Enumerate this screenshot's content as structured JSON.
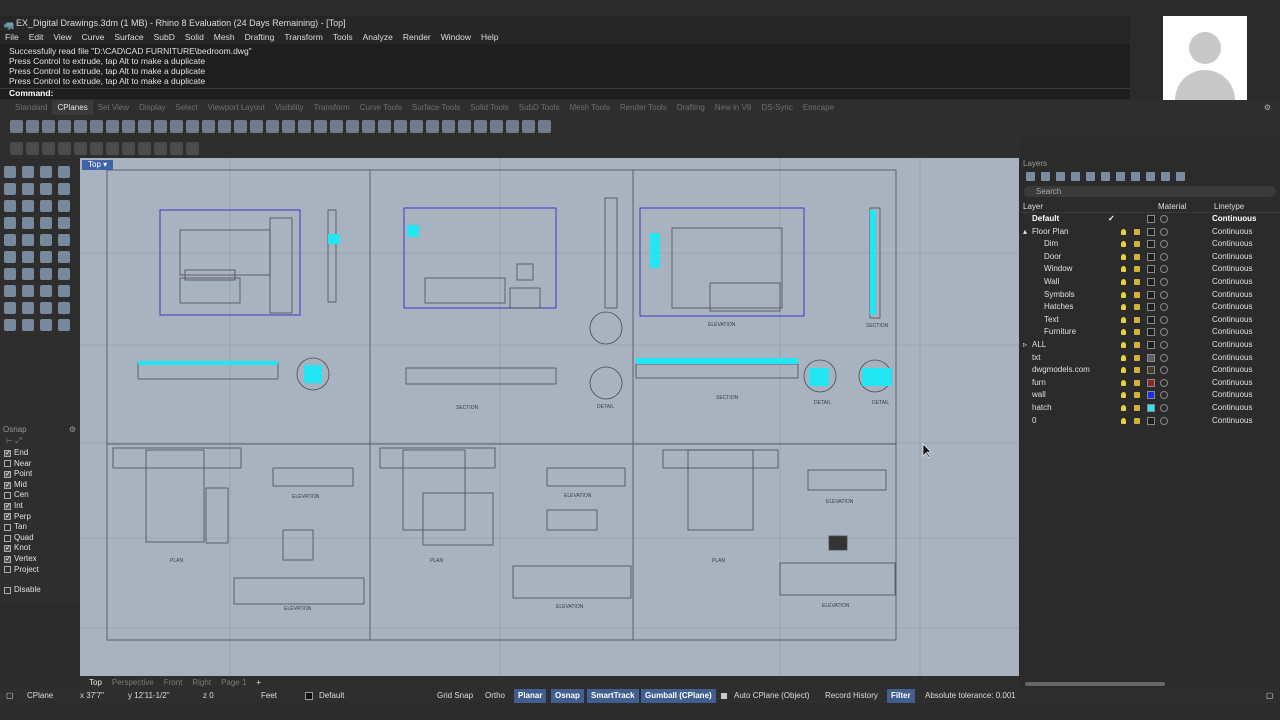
{
  "title": "EX_Digital Drawings.3dm (1 MB) - Rhino 8 Evaluation (24 Days Remaining) - [Top]",
  "menu": [
    "File",
    "Edit",
    "View",
    "Curve",
    "Surface",
    "SubD",
    "Solid",
    "Mesh",
    "Drafting",
    "Transform",
    "Tools",
    "Analyze",
    "Render",
    "Window",
    "Help"
  ],
  "command_history": [
    "Successfully read file \"D:\\CAD\\CAD FURNITURE\\bedroom.dwg\"",
    "Press Control to extrude, tap Alt to make a duplicate",
    "Press Control to extrude, tap Alt to make a duplicate",
    "Press Control to extrude, tap Alt to make a duplicate"
  ],
  "command_prompt": "Command:",
  "toolbar_tabs": [
    "Standard",
    "CPlanes",
    "Set View",
    "Display",
    "Select",
    "Viewport Layout",
    "Visibility",
    "Transform",
    "Curve Tools",
    "Surface Tools",
    "Solid Tools",
    "SubD Tools",
    "Mesh Tools",
    "Render Tools",
    "Drafting",
    "New in V8",
    "DS-Sync",
    "Enscape"
  ],
  "active_toolbar_tab": "CPlanes",
  "viewport": {
    "label": "Top",
    "drawing_labels": {
      "plan": "PLAN",
      "elevation": "ELEVATION",
      "section": "SECTION",
      "detail": "DETAIL"
    }
  },
  "osnap": {
    "title": "Osnap",
    "items": [
      {
        "label": "End",
        "checked": true
      },
      {
        "label": "Near",
        "checked": false
      },
      {
        "label": "Point",
        "checked": true
      },
      {
        "label": "Mid",
        "checked": true
      },
      {
        "label": "Cen",
        "checked": false
      },
      {
        "label": "Int",
        "checked": true
      },
      {
        "label": "Perp",
        "checked": true
      },
      {
        "label": "Tan",
        "checked": false
      },
      {
        "label": "Quad",
        "checked": false
      },
      {
        "label": "Knot",
        "checked": true
      },
      {
        "label": "Vertex",
        "checked": true
      },
      {
        "label": "Project",
        "checked": false
      }
    ],
    "disable": "Disable"
  },
  "view_tabs": [
    "Top",
    "Perspective",
    "Front",
    "Right",
    "Page 1"
  ],
  "view_tab_add": "+",
  "layers": {
    "title": "Layers",
    "search_placeholder": "Search",
    "col_layer": "Layer",
    "col_material": "Material",
    "col_linetype": "Linetype",
    "rows": [
      {
        "name": "Default",
        "indent": 0,
        "linetype": "Continuous",
        "color": "#1e1e1e",
        "bold": true,
        "current": true
      },
      {
        "name": "Floor Plan",
        "indent": 0,
        "linetype": "Continuous",
        "color": "#1e1e1e",
        "expand": "▴"
      },
      {
        "name": "Dim",
        "indent": 1,
        "linetype": "Continuous",
        "color": "#1e1e1e"
      },
      {
        "name": "Door",
        "indent": 1,
        "linetype": "Continuous",
        "color": "#1e1e1e"
      },
      {
        "name": "Window",
        "indent": 1,
        "linetype": "Continuous",
        "color": "#1e1e1e"
      },
      {
        "name": "Wall",
        "indent": 1,
        "linetype": "Continuous",
        "color": "#1e1e1e"
      },
      {
        "name": "Symbols",
        "indent": 1,
        "linetype": "Continuous",
        "color": "#1e1e1e"
      },
      {
        "name": "Hatches",
        "indent": 1,
        "linetype": "Continuous",
        "color": "#1e1e1e"
      },
      {
        "name": "Text",
        "indent": 1,
        "linetype": "Continuous",
        "color": "#1e1e1e"
      },
      {
        "name": "Furniture",
        "indent": 1,
        "linetype": "Continuous",
        "color": "#1e1e1e"
      },
      {
        "name": "ALL",
        "indent": 0,
        "linetype": "Continuous",
        "color": "#1e1e1e",
        "expand": "▹"
      },
      {
        "name": "txt",
        "indent": 0,
        "linetype": "Continuous",
        "color": "#56606e"
      },
      {
        "name": "dwgmodels.com",
        "indent": 0,
        "linetype": "Continuous",
        "color": "#4a3a2a"
      },
      {
        "name": "furn",
        "indent": 0,
        "linetype": "Continuous",
        "color": "#8b2a1e"
      },
      {
        "name": "wall",
        "indent": 0,
        "linetype": "Continuous",
        "color": "#1a2fe0"
      },
      {
        "name": "hatch",
        "indent": 0,
        "linetype": "Continuous",
        "color": "#2ee6f0"
      },
      {
        "name": "0",
        "indent": 0,
        "linetype": "Continuous",
        "color": "#1e1e1e"
      }
    ]
  },
  "status": {
    "cplane": "CPlane",
    "x": "x 37'7\"",
    "y": "y 12'11-1/2\"",
    "z": "z 0",
    "units": "Feet",
    "layer": "Default",
    "grid_snap": "Grid Snap",
    "ortho": "Ortho",
    "planar": "Planar",
    "osnap": "Osnap",
    "smarttrack": "SmartTrack",
    "gumball": "Gumball (CPlane)",
    "auto_cplane": "Auto CPlane (Object)",
    "record_history": "Record History",
    "filter": "Filter",
    "tolerance": "Absolute tolerance: 0.001"
  },
  "colors": {
    "accent": "#415e8f",
    "cyan": "#22e6f2",
    "drawing_blue": "#3b34c9",
    "viewport_bg": "#a9b3bf"
  }
}
